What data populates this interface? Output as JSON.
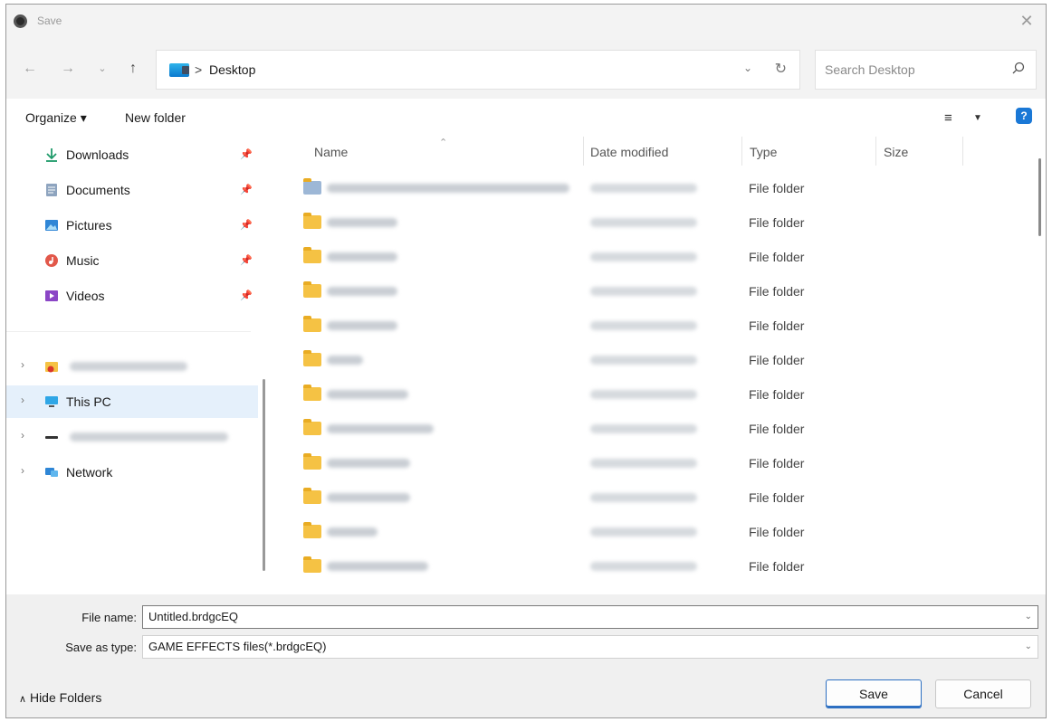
{
  "window": {
    "title": "Save"
  },
  "address": {
    "separator": ">",
    "path": "Desktop"
  },
  "search": {
    "placeholder": "Search Desktop"
  },
  "commands": {
    "organize": "Organize ▾",
    "new_folder": "New folder"
  },
  "nav": {
    "quick_access": [
      {
        "label": "Downloads",
        "icon": "download-icon"
      },
      {
        "label": "Documents",
        "icon": "document-icon"
      },
      {
        "label": "Pictures",
        "icon": "pictures-icon"
      },
      {
        "label": "Music",
        "icon": "music-icon"
      },
      {
        "label": "Videos",
        "icon": "videos-icon"
      }
    ],
    "this_pc": "This PC",
    "network": "Network"
  },
  "columns": {
    "name": "Name",
    "date": "Date modified",
    "type": "Type",
    "size": "Size"
  },
  "rows": [
    {
      "type": "File folder"
    },
    {
      "type": "File folder"
    },
    {
      "type": "File folder"
    },
    {
      "type": "File folder"
    },
    {
      "type": "File folder"
    },
    {
      "type": "File folder"
    },
    {
      "type": "File folder"
    },
    {
      "type": "File folder"
    },
    {
      "type": "File folder"
    },
    {
      "type": "File folder"
    },
    {
      "type": "File folder"
    },
    {
      "type": "File folder"
    }
  ],
  "fields": {
    "file_name_label": "File name:",
    "file_name_value": "Untitled.brdgcEQ",
    "save_type_label": "Save as type:",
    "save_type_value": "GAME EFFECTS files(*.brdgcEQ)"
  },
  "buttons": {
    "save": "Save",
    "cancel": "Cancel",
    "hide_folders": "Hide Folders"
  },
  "colors": {
    "accent": "#1a78d6",
    "folder": "#f5c244",
    "selected": "#e5f0fb"
  }
}
